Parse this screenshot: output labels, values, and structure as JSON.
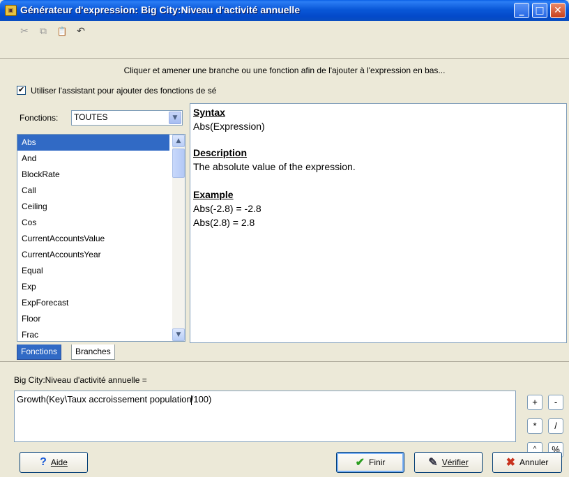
{
  "window": {
    "title": "Générateur d'expression: Big City:Niveau d'activité annuelle",
    "icon": "app-icon",
    "controls": [
      "minimize",
      "maximize",
      "close"
    ]
  },
  "toolbar": {
    "tools": [
      {
        "name": "cut-icon",
        "glyph": "✂"
      },
      {
        "name": "copy-icon",
        "glyph": "⧉"
      },
      {
        "name": "paste-icon",
        "glyph": "📋"
      },
      {
        "name": "undo-icon",
        "glyph": "↶"
      }
    ]
  },
  "hint": "Cliquer et amener une branche ou une fonction afin de l'ajouter à l'expression en bas...",
  "assistant": {
    "checked": true,
    "label": "Utiliser l'assistant pour ajouter des fonctions de sé"
  },
  "functions": {
    "label": "Fonctions:",
    "selected_category": "TOUTES",
    "items": [
      "Abs",
      "And",
      "BlockRate",
      "Call",
      "Ceiling",
      "Cos",
      "CurrentAccountsValue",
      "CurrentAccountsYear",
      "Equal",
      "Exp",
      "ExpForecast",
      "Floor",
      "Frac"
    ],
    "selected_index": 0
  },
  "help": {
    "syntax_heading": "Syntax",
    "syntax_text": "Abs(Expression)",
    "description_heading": "Description",
    "description_text": "The absolute value of the expression.",
    "example_heading": "Example",
    "example_lines": [
      "Abs(-2.8) = -2.8",
      "Abs(2.8) = 2.8"
    ]
  },
  "tabs": [
    {
      "label": "Fonctions",
      "active": true
    },
    {
      "label": "Branches",
      "active": false
    }
  ],
  "expression": {
    "label": "Big City:Niveau d'activité annuelle =",
    "value_before_caret": "Growth(Key\\Taux accroissement population",
    "value_after_caret": "/100)"
  },
  "operators": [
    "+",
    "-",
    "*",
    "/",
    "^",
    "%"
  ],
  "buttons": {
    "help": "Aide",
    "finish": "Finir",
    "verify": "Vérifier",
    "cancel": "Annuler"
  }
}
